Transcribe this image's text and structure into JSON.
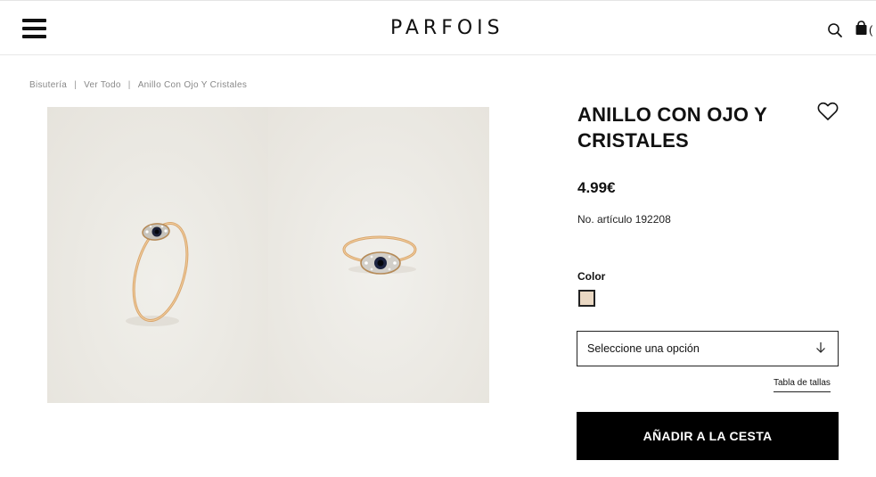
{
  "header": {
    "logo_text": "PARFOIS",
    "icons": {
      "menu": "hamburger-menu-icon",
      "search": "search-icon",
      "bag": "shopping-bag-icon"
    },
    "bag_count_fragment": "("
  },
  "breadcrumb": {
    "items": [
      "Bisutería",
      "Ver Todo",
      "Anillo Con Ojo Y Cristales"
    ],
    "separator": "|"
  },
  "product": {
    "title": "ANILLO CON OJO Y CRISTALES",
    "price": "4.99€",
    "sku_text": "No. artículo 192208",
    "color_label": "Color",
    "selected_color": "#ead8c3",
    "size_select_placeholder": "Seleccione una opción",
    "size_guide_label": "Tabla de tallas",
    "add_to_cart_label": "AÑADIR A LA CESTA"
  },
  "colors": {
    "primary": "#000000",
    "text": "#111111",
    "muted": "#888888",
    "gold": "#d9a66e"
  }
}
